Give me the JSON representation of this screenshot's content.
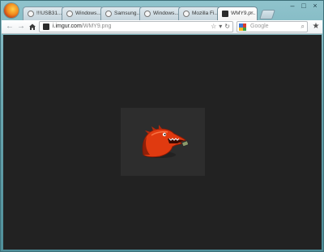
{
  "browser": {
    "tabs": [
      {
        "label": "!!!USB31...",
        "active": false
      },
      {
        "label": "Windows...",
        "active": false
      },
      {
        "label": "Samsung...",
        "active": false
      },
      {
        "label": "Windows...",
        "active": false
      },
      {
        "label": "Mozilla Fi...",
        "active": false
      },
      {
        "label": "WMY9.p...",
        "active": true
      }
    ]
  },
  "toolbar": {
    "url_host": "i.imgur.com",
    "url_path": "/WMY9.png",
    "search_placeholder": "Google"
  },
  "icons": {
    "back": "back-arrow-icon",
    "forward": "forward-arrow-icon",
    "home": "home-icon",
    "bookmark": "star-icon",
    "reload": "reload-icon",
    "dropdown": "chevron-down-icon",
    "search_go": "magnifier-icon"
  },
  "colors": {
    "page_background": "#222222",
    "image_background": "#2d2d2d",
    "dinosaur": "#e03a10"
  }
}
